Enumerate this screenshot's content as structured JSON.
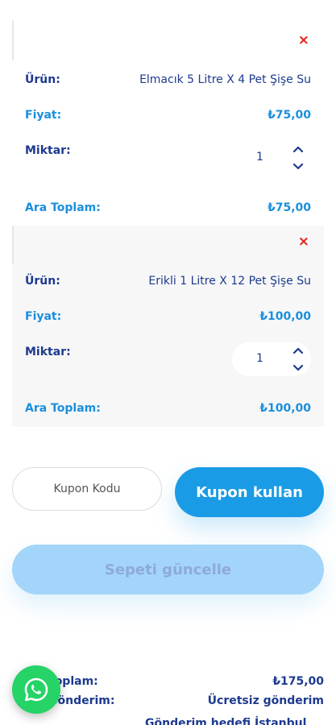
{
  "cart": {
    "items": [
      {
        "product_label": "Ürün:",
        "product_name": "Elmacık 5 Litre X 4 Pet Şişe Su",
        "price_label": "Fiyat:",
        "price": "₺75,00",
        "qty_label": "Miktar:",
        "qty": "1",
        "subtotal_label": "Ara Toplam:",
        "subtotal": "₺75,00",
        "remove": "×"
      },
      {
        "product_label": "Ürün:",
        "product_name": "Erikli 1 Litre X 12 Pet Şişe Su",
        "price_label": "Fiyat:",
        "price": "₺100,00",
        "qty_label": "Miktar:",
        "qty": "1",
        "subtotal_label": "Ara Toplam:",
        "subtotal": "₺100,00",
        "remove": "×"
      }
    ]
  },
  "coupon": {
    "placeholder": "Kupon Kodu",
    "apply_label": "Kupon kullan"
  },
  "update_cart_label": "Sepeti güncelle",
  "totals": {
    "subtotal_label": "Toplam:",
    "subtotal": "₺175,00",
    "shipping_label": "Gönderim:",
    "shipping": "Ücretsiz gönderim",
    "cutoff_text": "Gönderim hedefi İstanbul"
  },
  "icons": {
    "remove": "close-icon",
    "qty_up": "chevron-up-icon",
    "qty_down": "chevron-down-icon",
    "whatsapp": "whatsapp-icon"
  },
  "colors": {
    "navy": "#1d3a8f",
    "accent": "#1a9be6",
    "disabled": "#a3d5fa",
    "remove": "#e3231b",
    "whatsapp": "#25d366"
  }
}
